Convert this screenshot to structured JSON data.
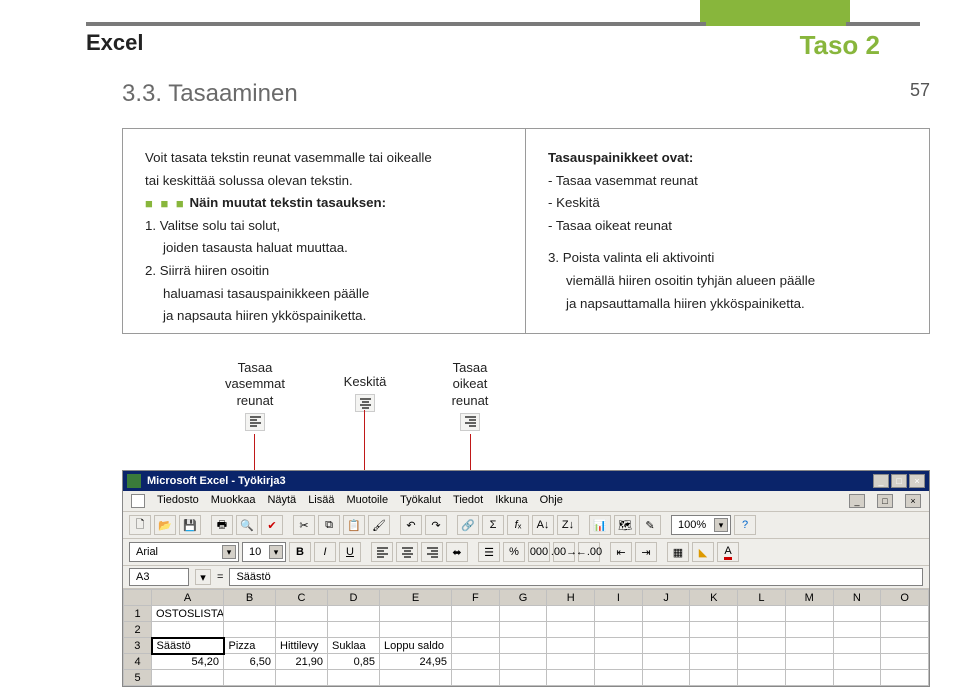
{
  "header": {
    "app": "Excel",
    "level": "Taso 2",
    "pageno": "57"
  },
  "heading": "3.3. Tasaaminen",
  "colA": {
    "p1a": "Voit tasata tekstin reunat vasemmalle tai oikealle",
    "p1b": "tai keskittää solussa olevan tekstin.",
    "sub": "Näin muutat tekstin tasauksen:",
    "s1a": "1. Valitse solu tai solut,",
    "s1b": "joiden tasausta haluat muuttaa.",
    "s2a": "2. Siirrä hiiren osoitin",
    "s2b": "haluamasi tasauspainikkeen päälle",
    "s2c": "ja napsauta hiiren ykköspainiketta."
  },
  "colB": {
    "t": "Tasauspainikkeet ovat:",
    "b1": "- Tasaa vasemmat reunat",
    "b2": "- Keskitä",
    "b3": "- Tasaa oikeat reunat",
    "s3a": "3. Poista valinta eli aktivointi",
    "s3b": "viemällä hiiren osoitin tyhjän alueen päälle",
    "s3c": "ja napsauttamalla hiiren ykköspainiketta."
  },
  "callouts": {
    "left": "Tasaa\nvasemmat\nreunat",
    "mid": "Keskitä",
    "right": "Tasaa\noikeat\nreunat"
  },
  "shot": {
    "title": "Microsoft Excel - Työkirja3",
    "menus": [
      "Tiedosto",
      "Muokkaa",
      "Näytä",
      "Lisää",
      "Muotoile",
      "Työkalut",
      "Tiedot",
      "Ikkuna",
      "Ohje"
    ],
    "font": "Arial",
    "fontsize": "10",
    "zoom": "100%",
    "namebox": "A3",
    "formula": "Säästö",
    "cols": [
      "A",
      "B",
      "C",
      "D",
      "E",
      "F",
      "G",
      "H",
      "I",
      "J",
      "K",
      "L",
      "M",
      "N",
      "O"
    ],
    "rows": {
      "r1": {
        "A": "OSTOSLISTA"
      },
      "r2": {},
      "r3": {
        "A": "Säästö",
        "B": "Pizza",
        "C": "Hittilevy",
        "D": "Suklaa",
        "E": "Loppu saldo"
      },
      "r4": {
        "A": "54,20",
        "B": "6,50",
        "C": "21,90",
        "D": "0,85",
        "E": "24,95"
      },
      "r5": {}
    }
  },
  "icons": {
    "alignLeft": "align-left-icon",
    "alignCenter": "align-center-icon",
    "alignRight": "align-right-icon"
  }
}
